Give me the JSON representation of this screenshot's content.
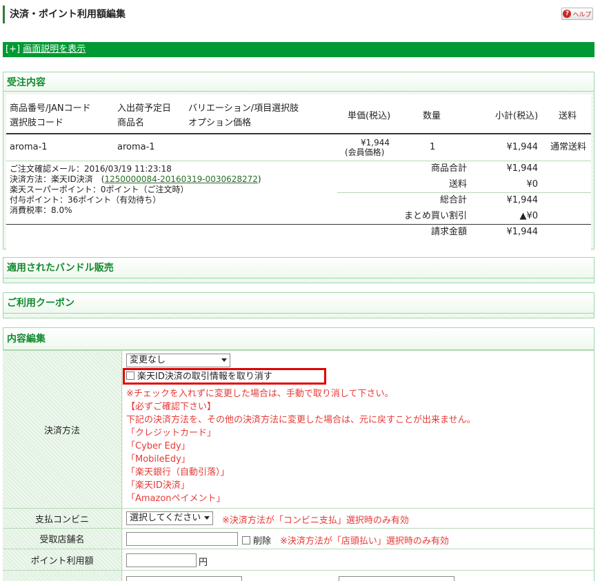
{
  "header": {
    "title": "決済・ポイント利用額編集",
    "help_label": "ヘルプ"
  },
  "info_bar": {
    "toggle": "[+]",
    "link": "画面説明を表示"
  },
  "order_section": {
    "title": "受注内容",
    "headers": {
      "col1_line1": "商品番号/JANコード",
      "col1_line2": "選択肢コード",
      "col2_line1": "入出荷予定日",
      "col2_line2": "商品名",
      "col3_line1": "バリエーション/項目選択肢",
      "col3_line2": "オプション価格",
      "price": "単価(税込)",
      "qty": "数量",
      "subtotal": "小計(税込)",
      "shipping": "送料"
    },
    "item": {
      "code": "aroma-1",
      "name": "aroma-1",
      "price": "¥1,944",
      "price_note": "(会員価格)",
      "qty": "1",
      "subtotal": "¥1,944",
      "shipping": "通常送料"
    },
    "info": {
      "mail": "ご注文確認メール：2016/03/19 11:23:18",
      "payment_prefix": "決済方法：楽天ID決済　(",
      "payment_link": "1250000084-20160319-0030628272",
      "payment_suffix": ")",
      "super_point": "楽天スーパーポイント：0ポイント（ご注文時）",
      "grant_point": "付与ポイント：36ポイント（有効待ち）",
      "tax_rate": "消費税率：8.0%"
    },
    "summary": [
      {
        "label": "商品合計",
        "value": "¥1,944"
      },
      {
        "label": "送料",
        "value": "¥0"
      },
      {
        "label": "総合計",
        "value": "¥1,944"
      },
      {
        "label": "まとめ買い割引",
        "value": "▲¥0"
      },
      {
        "label": "請求金額",
        "value": "¥1,944"
      }
    ]
  },
  "bundle_section": {
    "title": "適用されたバンドル販売"
  },
  "coupon_section": {
    "title": "ご利用クーポン"
  },
  "edit_section": {
    "title": "内容編集",
    "payment_label": "決済方法",
    "payment_select": "変更なし",
    "cancel_checkbox": "楽天ID決済の取引情報を取り消す",
    "notes": [
      "※チェックを入れずに変更した場合は、手動で取り消して下さい。",
      "【必ずご確認下さい】",
      "下記の決済方法を、その他の決済方法に変更した場合は、元に戻すことが出来ません。",
      "「クレジットカード」",
      "「Cyber Edy」",
      "「MobileEdy」",
      "「楽天銀行（自動引落）」",
      "「楽天ID決済」",
      "「Amazonペイメント」"
    ],
    "convenience_label": "支払コンビニ",
    "convenience_select": "選択してください",
    "convenience_note": "※決済方法が「コンビニ支払」選択時のみ有効",
    "store_label": "受取店舗名",
    "store_delete": "削除",
    "store_note": "※決済方法が「店頭払い」選択時のみ有効",
    "point_label": "ポイント利用額",
    "point_unit": "円"
  }
}
